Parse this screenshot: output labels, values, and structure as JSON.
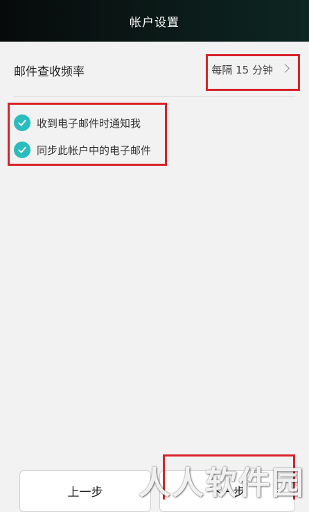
{
  "header": {
    "title": "帐户设置"
  },
  "frequency": {
    "label": "邮件查收频率",
    "value": "每隔 15 分钟"
  },
  "options": [
    {
      "label": "收到电子邮件时通知我",
      "checked": true
    },
    {
      "label": "同步此帐户中的电子邮件",
      "checked": true
    }
  ],
  "buttons": {
    "prev": "上一步",
    "next": "下一步"
  },
  "watermark": "人人软件园",
  "colors": {
    "accent": "#2bbdbd",
    "highlight": "#d8232a"
  }
}
